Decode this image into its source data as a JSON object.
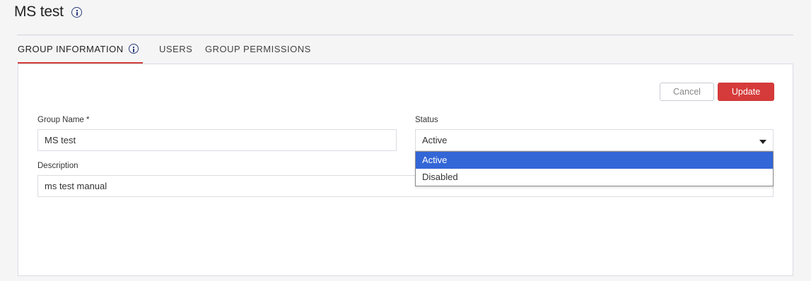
{
  "page": {
    "title": "MS test"
  },
  "tabs": [
    {
      "label": "GROUP INFORMATION",
      "active": true
    },
    {
      "label": "USERS",
      "active": false
    },
    {
      "label": "GROUP PERMISSIONS",
      "active": false
    }
  ],
  "actions": {
    "cancel_label": "Cancel",
    "update_label": "Update"
  },
  "form": {
    "group_name_label": "Group Name *",
    "group_name_value": "MS test",
    "status_label": "Status",
    "status_value": "Active",
    "description_label": "Description",
    "description_value": "ms test manual"
  },
  "status_dropdown": {
    "options": [
      "Active",
      "Disabled"
    ],
    "selected_index": 0
  },
  "colors": {
    "accent_red": "#d63b3b",
    "selection_blue": "#3366d6",
    "info_icon": "#2c3e7a"
  },
  "icons": {
    "title_info": "info-icon",
    "tab_info": "info-icon",
    "select_caret": "caret-down-icon"
  }
}
